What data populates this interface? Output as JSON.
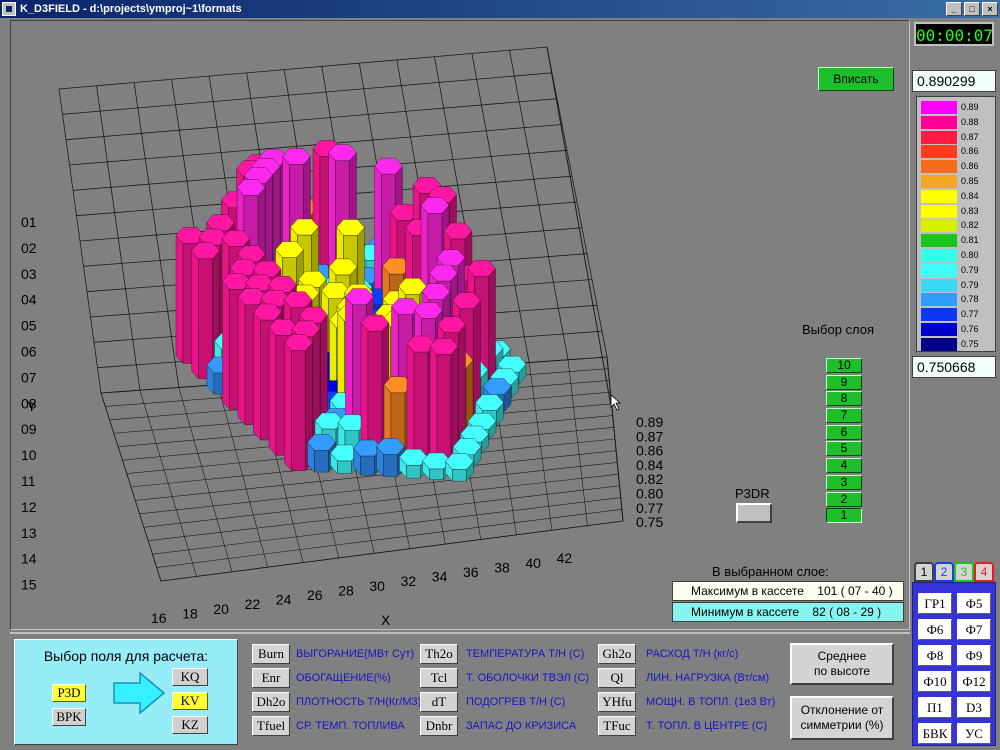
{
  "window": {
    "title": "K_D3FIELD - d:\\projects\\ymproj~1\\formats"
  },
  "timer": "00:00:07",
  "fit_button": "Вписать",
  "scale": {
    "max": "0.890299",
    "min": "0.750668",
    "legend": [
      {
        "label": "0.89",
        "color": "#ff00ff"
      },
      {
        "label": "0.88",
        "color": "#ff0099"
      },
      {
        "label": "0.87",
        "color": "#ff1b46"
      },
      {
        "label": "0.86",
        "color": "#ff3c1e"
      },
      {
        "label": "0.86",
        "color": "#f26c1a"
      },
      {
        "label": "0.85",
        "color": "#f5a623"
      },
      {
        "label": "0.84",
        "color": "#ffff00"
      },
      {
        "label": "0.83",
        "color": "#ffff00"
      },
      {
        "label": "0.82",
        "color": "#d8f000"
      },
      {
        "label": "0.81",
        "color": "#1cc51c"
      },
      {
        "label": "0.80",
        "color": "#35ffe8"
      },
      {
        "label": "0.79",
        "color": "#3ffcfc"
      },
      {
        "label": "0.79",
        "color": "#38d8f0"
      },
      {
        "label": "0.78",
        "color": "#2f9df5"
      },
      {
        "label": "0.77",
        "color": "#0a39f5"
      },
      {
        "label": "0.76",
        "color": "#0000cc"
      },
      {
        "label": "0.75",
        "color": "#000088"
      }
    ]
  },
  "plot": {
    "y_axis_label": "Y",
    "x_axis_label": "X",
    "y_ticks": [
      "01",
      "02",
      "03",
      "04",
      "05",
      "06",
      "07",
      "08",
      "09",
      "10",
      "11",
      "12",
      "13",
      "14",
      "15"
    ],
    "x_ticks": [
      "16",
      "18",
      "20",
      "22",
      "24",
      "26",
      "28",
      "30",
      "32",
      "34",
      "36",
      "38",
      "40",
      "42"
    ],
    "z_ticks": [
      "0.89",
      "0.87",
      "0.86",
      "0.84",
      "0.82",
      "0.80",
      "0.77",
      "0.75"
    ]
  },
  "layer_select": {
    "caption": "Выбор слоя",
    "layers": [
      "10",
      "9",
      "8",
      "7",
      "6",
      "5",
      "4",
      "3",
      "2",
      "1"
    ],
    "selected": "1"
  },
  "p3dr_label": "P3DR",
  "selected_layer": {
    "caption": "В выбранном слое:",
    "max_label": "Максимум в кассете",
    "max_value": "101 ( 07 - 40 )",
    "min_label": "Минимум в кассете",
    "min_value": "82 ( 08 - 29 )"
  },
  "field_select": {
    "caption": "Выбор поля для расчета:",
    "left_buttons": [
      "P3D",
      "BPK"
    ],
    "right_buttons": [
      "KQ",
      "KV",
      "KZ"
    ]
  },
  "fields": [
    {
      "code": "Burn",
      "label": "ВЫГОРАНИЕ(МВт Сут)"
    },
    {
      "code": "Enr",
      "label": "ОБОГАЩЕНИЕ(%)"
    },
    {
      "code": "Dh2o",
      "label": "ПЛОТНОСТЬ Т/Н(Кг/М3)"
    },
    {
      "code": "Tfuel",
      "label": "СР. ТЕМП. ТОПЛИВА"
    },
    {
      "code": "Th2o",
      "label": "ТЕМПЕРАТУРА Т/Н (С)"
    },
    {
      "code": "Tcl",
      "label": "Т. ОБОЛОЧКИ ТВЭЛ (С)"
    },
    {
      "code": "dT",
      "label": "ПОДОГРЕВ Т/Н (С)"
    },
    {
      "code": "Dnbr",
      "label": "ЗАПАС ДО КРИЗИСА"
    },
    {
      "code": "Gh2o",
      "label": "РАСХОД Т/Н (кг/с)"
    },
    {
      "code": "Ql",
      "label": "ЛИН. НАГРУЗКА (Вт/см)"
    },
    {
      "code": "YHfu",
      "label": "МОЩН. В ТОПЛ. (1е3 Вт)"
    },
    {
      "code": "TFuc",
      "label": "Т. ТОПЛ. В ЦЕНТРЕ (С)"
    }
  ],
  "actions": {
    "avg_height": "Среднее\nпо высоте",
    "symmetry": "Отклонение от\nсимметрии (%)"
  },
  "tabs": [
    "1",
    "2",
    "3",
    "4"
  ],
  "tab_buttons": [
    "ГР1",
    "Ф5",
    "Ф6",
    "Ф7",
    "Ф8",
    "Ф9",
    "Ф10",
    "Ф12",
    "П1",
    "D3",
    "БВК",
    "УС"
  ]
}
